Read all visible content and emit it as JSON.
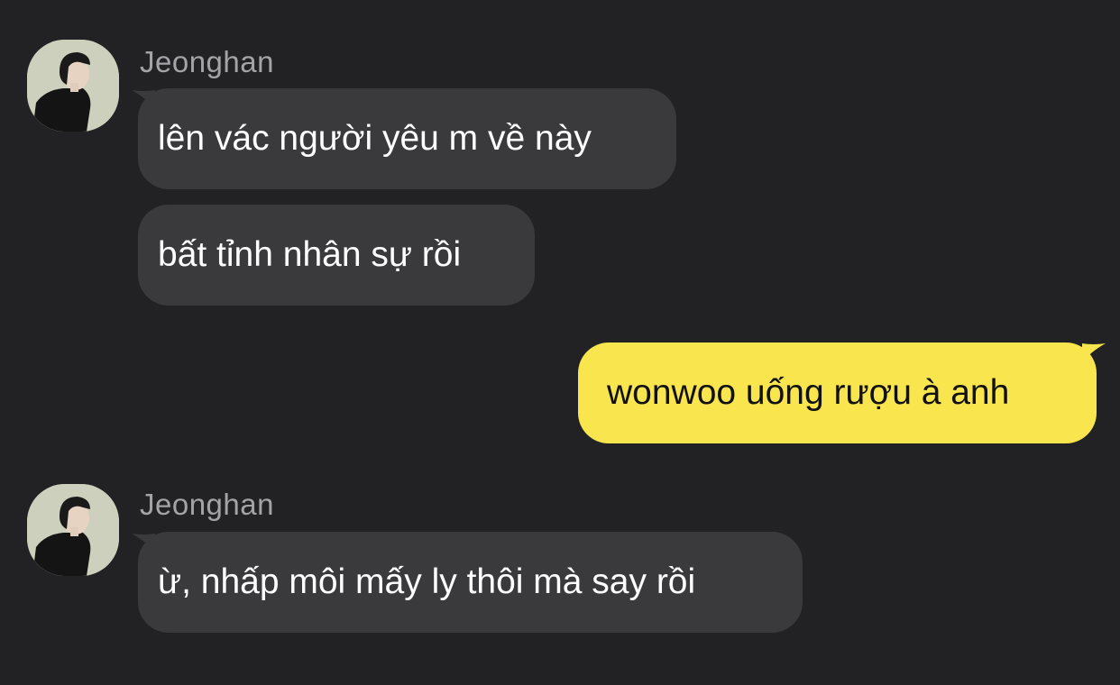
{
  "conversation": {
    "groups": [
      {
        "sender": "Jeonghan",
        "avatar": "profile-photo",
        "messages": [
          "lên vác người yêu m về này",
          "bất tỉnh nhân sự rồi"
        ]
      },
      {
        "sender": "me",
        "messages": [
          "wonwoo uống rượu à anh"
        ]
      },
      {
        "sender": "Jeonghan",
        "avatar": "profile-photo",
        "messages": [
          "ừ, nhấp môi mấy ly thôi mà say rồi"
        ]
      }
    ]
  },
  "colors": {
    "background": "#222224",
    "incoming_bubble": "#3a3a3c",
    "outgoing_bubble": "#f9e54d",
    "sender_name": "#a3a3a8"
  }
}
